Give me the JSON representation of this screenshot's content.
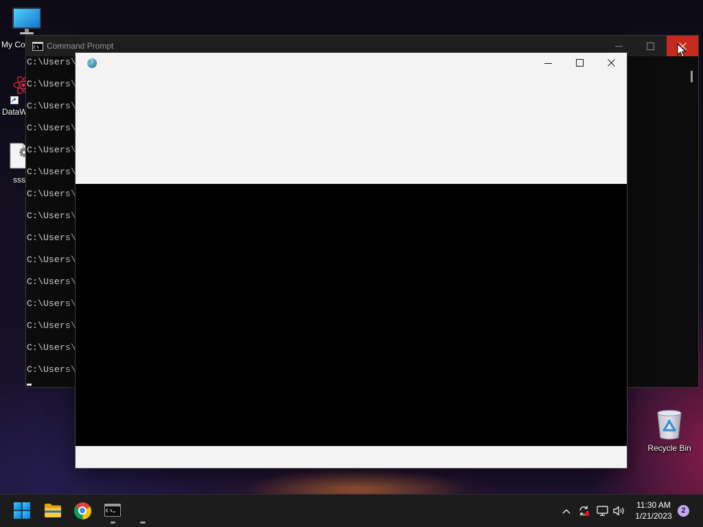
{
  "desktop": {
    "icons": {
      "my_computer": {
        "label": "My Co",
        "icon": "monitor-icon"
      },
      "dataw": {
        "label": "DataW",
        "icon": "atom-icon"
      },
      "ssss": {
        "label": "ssss",
        "icon": "settings-document-icon"
      },
      "recycle_bin": {
        "label": "Recycle Bin",
        "icon": "recycle-bin-icon"
      }
    }
  },
  "cmd_window": {
    "title": "Command Prompt",
    "icon": "command-prompt-icon",
    "lines": [
      "C:\\Users\\",
      "C:\\Users\\",
      "C:\\Users\\",
      "C:\\Users\\",
      "C:\\Users\\",
      "C:\\Users\\",
      "C:\\Users\\",
      "C:\\Users\\",
      "C:\\Users\\",
      "C:\\Users\\",
      "C:\\Users\\",
      "C:\\Users\\",
      "C:\\Users\\",
      "C:\\Users\\",
      "C:\\Users\\"
    ]
  },
  "front_window": {
    "icon": "globe-icon"
  },
  "taskbar": {
    "apps": [
      {
        "icon": "windows-start-icon",
        "running": false
      },
      {
        "icon": "file-explorer-icon",
        "running": false
      },
      {
        "icon": "chrome-icon",
        "running": false
      },
      {
        "icon": "command-prompt-icon",
        "running": true
      },
      {
        "icon": "window-icon",
        "running": true
      }
    ],
    "tray_icons": [
      "chevron-up-icon",
      "sync-icon",
      "network-icon",
      "volume-icon"
    ],
    "clock": {
      "time": "11:30 AM",
      "date": "1/21/2023"
    },
    "notification_count": "2"
  },
  "colors": {
    "close_hover": "#c42b1c",
    "cmd_background": "#0c0c0c",
    "cmd_titlebar": "#202020",
    "window_chrome": "#f3f3f3",
    "taskbar": "#1c1c1c",
    "start_blue": "#1a9fe6",
    "badge": "#c7a6f5"
  }
}
